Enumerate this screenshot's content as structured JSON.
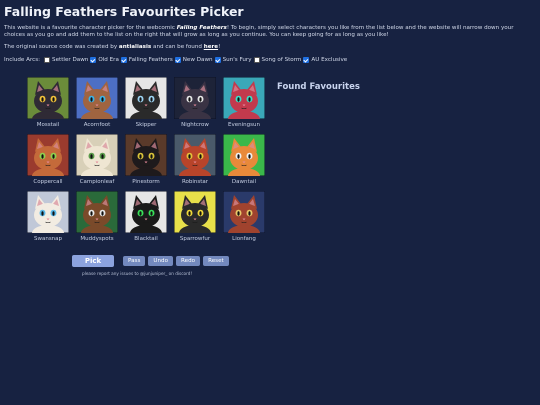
{
  "page": {
    "title": "Falling Feathers Favourites Picker",
    "intro_before": "This website is a favourite character picker for the webcomic ",
    "intro_comic": "Falling Feathers",
    "intro_after": "! To begin, simply select characters you like from the list below and the website will narrow down your choices as you go and add them to the list on the right that will grow as long as you continue. You can keep going for as long as you like!",
    "credit_before": "The original source code was created by ",
    "credit_author": "antialiasis",
    "credit_middle": " and can be found ",
    "credit_link": "here",
    "credit_end": "!"
  },
  "arcs": {
    "label": "Include Arcs:",
    "items": [
      {
        "label": "Settler Dawn",
        "checked": false
      },
      {
        "label": "Old Era",
        "checked": true
      },
      {
        "label": "Falling Feathers",
        "checked": true
      },
      {
        "label": "New Dawn",
        "checked": true
      },
      {
        "label": "Sun's Fury",
        "checked": true
      },
      {
        "label": "Song of Storm",
        "checked": false
      },
      {
        "label": "AU Exclusive",
        "checked": true
      }
    ]
  },
  "characters": [
    {
      "name": "Mosstail",
      "bg": "#6b8c3a",
      "fur": "#2f2a35",
      "eye": "#f2c23a"
    },
    {
      "name": "Acornfoot",
      "bg": "#4d6fc4",
      "fur": "#a06440",
      "eye": "#3bb3e8"
    },
    {
      "name": "Skipper",
      "bg": "#e6e6e6",
      "fur": "#2a2a2a",
      "eye": "#9dd4f2"
    },
    {
      "name": "Nightcrow",
      "bg": "#1d2338",
      "fur": "#3a3344",
      "eye": "#e8e8e8"
    },
    {
      "name": "Eveningsun",
      "bg": "#3aa8b8",
      "fur": "#c23a4d",
      "eye": "#3ae0c8"
    },
    {
      "name": "Coppercall",
      "bg": "#9a3b2e",
      "fur": "#c46a3a",
      "eye": "#8fd14f"
    },
    {
      "name": "Campionleaf",
      "bg": "#d8d0b8",
      "fur": "#efe6d2",
      "eye": "#5a9a4a"
    },
    {
      "name": "Pinestorm",
      "bg": "#5a3a2a",
      "fur": "#1e1a1c",
      "eye": "#d8c23a"
    },
    {
      "name": "Robinstar",
      "bg": "#4a5a6a",
      "fur": "#b8442a",
      "eye": "#e6c03a"
    },
    {
      "name": "Dawntail",
      "bg": "#3ab84a",
      "fur": "#e8893a",
      "eye": "#f0f0f0"
    },
    {
      "name": "Swansnap",
      "bg": "#c0c8d8",
      "fur": "#f2ece2",
      "eye": "#5ab8e8"
    },
    {
      "name": "Muddyspots",
      "bg": "#2a6a3a",
      "fur": "#7a4a2a",
      "eye": "#e8e8e8"
    },
    {
      "name": "Blacktail",
      "bg": "#e6e6e6",
      "fur": "#1a1a1a",
      "eye": "#3ae05a"
    },
    {
      "name": "Sparrowfur",
      "bg": "#e8e04a",
      "fur": "#2a2a2a",
      "eye": "#f0d83a"
    },
    {
      "name": "Lionfang",
      "bg": "#2a3a6a",
      "fur": "#a0432e",
      "eye": "#e8c86a"
    }
  ],
  "results": {
    "heading": "Found Favourites"
  },
  "controls": {
    "pick": "Pick",
    "pass": "Pass",
    "undo": "Undo",
    "redo": "Redo",
    "reset": "Reset"
  },
  "footer": {
    "report": "please report any issues to @junjuniper_ on discord!"
  }
}
